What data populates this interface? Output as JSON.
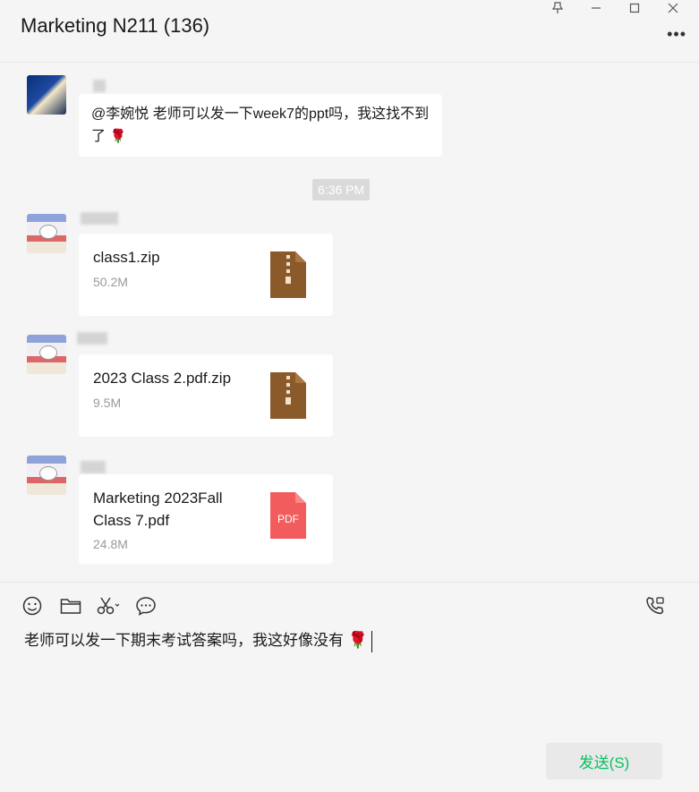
{
  "window": {
    "title": "Marketing N211 (136)",
    "controls": [
      "pin-icon",
      "minimize-icon",
      "maximize-icon",
      "close-icon"
    ],
    "more_icon": "more-icon"
  },
  "messages": {
    "text": {
      "body": "@李婉悦 老师可以发一下week7的ppt吗，我这找不到了",
      "emoji": "🌹"
    },
    "timestamp": "6:36 PM",
    "files": [
      {
        "name": "class1.zip",
        "size": "50.2M",
        "icon": "zip-icon"
      },
      {
        "name": "2023 Class 2.pdf.zip",
        "size": "9.5M",
        "icon": "zip-icon"
      },
      {
        "name": "Marketing 2023Fall Class 7.pdf",
        "size": "24.8M",
        "icon": "pdf-icon",
        "icon_label": "PDF"
      }
    ]
  },
  "toolbar": {
    "items": [
      "emoji-icon",
      "folder-icon",
      "screenshot-icon",
      "chat-history-icon"
    ],
    "call_icon": "voice-call-icon"
  },
  "composer": {
    "text": "老师可以发一下期末考试答案吗，我这好像没有",
    "emoji": "🌹",
    "send_label": "发送(S)"
  },
  "colors": {
    "accent": "#07c160",
    "zip": "#8b5a2b",
    "pdf": "#f25c5c"
  }
}
